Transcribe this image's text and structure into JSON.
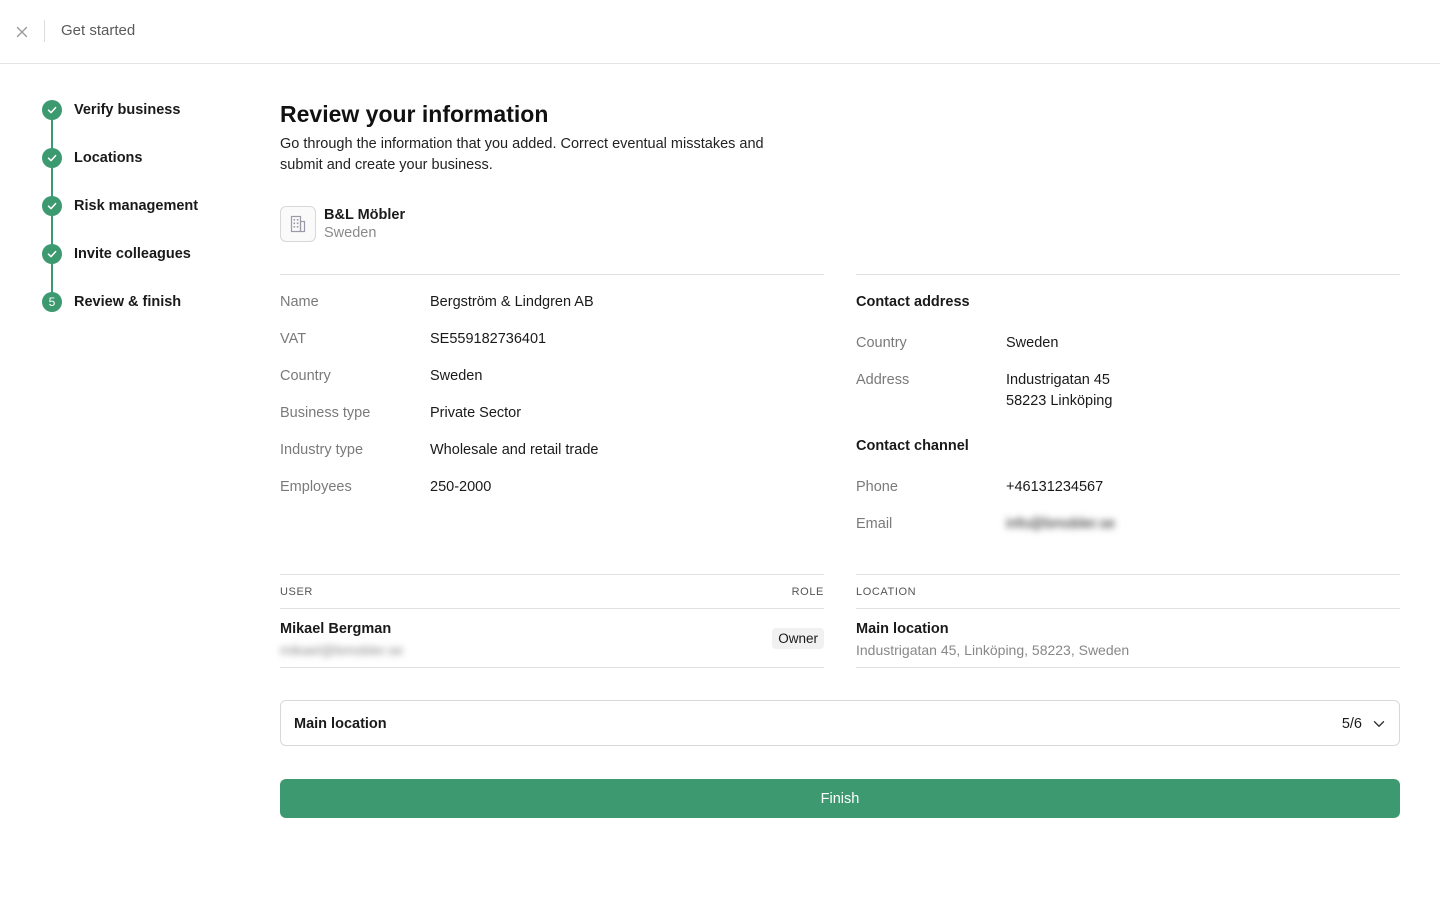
{
  "header": {
    "title": "Get started"
  },
  "steps": [
    {
      "label": "Verify business",
      "status": "done"
    },
    {
      "label": "Locations",
      "status": "done"
    },
    {
      "label": "Risk management",
      "status": "done"
    },
    {
      "label": "Invite colleagues",
      "status": "done"
    },
    {
      "label": "Review & finish",
      "status": "current",
      "number": "5"
    }
  ],
  "main": {
    "title": "Review your information",
    "description": "Go through the information that you added. Correct eventual misstakes and submit and create your business."
  },
  "business": {
    "name": "B&L Möbler",
    "country": "Sweden"
  },
  "details": [
    {
      "label": "Name",
      "value": "Bergström & Lindgren AB"
    },
    {
      "label": "VAT",
      "value": "SE559182736401"
    },
    {
      "label": "Country",
      "value": "Sweden"
    },
    {
      "label": "Business type",
      "value": "Private Sector"
    },
    {
      "label": "Industry type",
      "value": "Wholesale and retail trade"
    },
    {
      "label": "Employees",
      "value": "250-2000"
    }
  ],
  "contact": {
    "address_heading": "Contact address",
    "country_label": "Country",
    "country_value": "Sweden",
    "address_label": "Address",
    "address_line1": "Industrigatan 45",
    "address_line2": "58223 Linköping",
    "channel_heading": "Contact channel",
    "phone_label": "Phone",
    "phone_value": "+46131234567",
    "email_label": "Email",
    "email_value": "info@bmobler.se"
  },
  "users_table": {
    "col_user": "USER",
    "col_role": "ROLE",
    "rows": [
      {
        "name": "Mikael Bergman",
        "email": "mikael@bmobler.se",
        "role": "Owner"
      }
    ]
  },
  "locations_table": {
    "col_location": "LOCATION",
    "rows": [
      {
        "name": "Main location",
        "address": "Industrigatan 45, Linköping, 58223, Sweden"
      }
    ]
  },
  "location_select": {
    "label": "Main location",
    "count": "5/6"
  },
  "finish_label": "Finish",
  "colors": {
    "accent": "#3d9970",
    "border": "#e0e0e0",
    "muted": "#7a7a7a"
  }
}
